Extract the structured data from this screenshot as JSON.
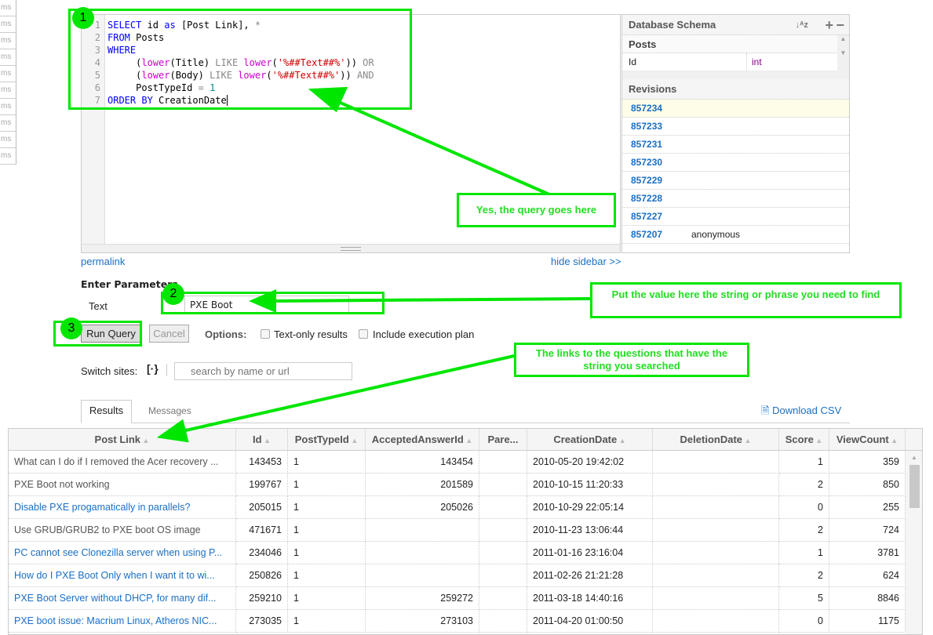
{
  "side_labels": [
    "ms",
    "ms",
    "ms",
    "ms",
    "ms",
    "ms",
    "ms",
    "ms",
    "ms",
    "ms"
  ],
  "editor": {
    "line_numbers": [
      "1",
      "2",
      "3",
      "4",
      "5",
      "6",
      "7"
    ]
  },
  "schema": {
    "title": "Database Schema",
    "table": "Posts",
    "column": {
      "name": "Id",
      "type": "int"
    },
    "revisions_title": "Revisions",
    "revisions": [
      {
        "id": "857234",
        "user": ""
      },
      {
        "id": "857233",
        "user": ""
      },
      {
        "id": "857231",
        "user": ""
      },
      {
        "id": "857230",
        "user": ""
      },
      {
        "id": "857229",
        "user": ""
      },
      {
        "id": "857228",
        "user": ""
      },
      {
        "id": "857227",
        "user": ""
      },
      {
        "id": "857207",
        "user": "anonymous"
      }
    ]
  },
  "links": {
    "permalink": "permalink",
    "hide_sidebar": "hide sidebar >>"
  },
  "params": {
    "heading": "Enter Parameters",
    "label": "Text",
    "value": "PXE Boot"
  },
  "actions": {
    "run": "Run Query",
    "cancel": "Cancel",
    "options": "Options:",
    "text_only": "Text-only results",
    "exec_plan": "Include execution plan"
  },
  "switch": {
    "label": "Switch sites:",
    "placeholder": "search by name or url"
  },
  "tabs": {
    "results": "Results",
    "messages": "Messages",
    "download": "Download CSV"
  },
  "table": {
    "headers": [
      "Post Link",
      "Id",
      "PostTypeId",
      "AcceptedAnswerId",
      "Pare...",
      "CreationDate",
      "DeletionDate",
      "Score",
      "ViewCount"
    ],
    "rows": [
      [
        "What can I do if I removed the Acer recovery ...",
        "143453",
        "1",
        "143454",
        "",
        "2010-05-20 19:42:02",
        "",
        "1",
        "359"
      ],
      [
        "PXE Boot not working",
        "199767",
        "1",
        "201589",
        "",
        "2010-10-15 11:20:33",
        "",
        "2",
        "850"
      ],
      [
        "Disable PXE progamatically in parallels?",
        "205015",
        "1",
        "205026",
        "",
        "2010-10-29 22:05:14",
        "",
        "0",
        "255"
      ],
      [
        "Use GRUB/GRUB2 to PXE boot OS image",
        "471671",
        "1",
        "",
        "",
        "2010-11-23 13:06:44",
        "",
        "2",
        "724"
      ],
      [
        "PC cannot see Clonezilla server when using P...",
        "234046",
        "1",
        "",
        "",
        "2011-01-16 23:16:04",
        "",
        "1",
        "3781"
      ],
      [
        "How do I PXE Boot Only when I want it to wi...",
        "250826",
        "1",
        "",
        "",
        "2011-02-26 21:21:28",
        "",
        "2",
        "624"
      ],
      [
        "PXE Boot Server without DHCP, for many dif...",
        "259210",
        "1",
        "259272",
        "",
        "2011-03-18 14:40:16",
        "",
        "5",
        "8846"
      ],
      [
        "PXE boot issue: Macrium Linux, Atheros NIC...",
        "273035",
        "1",
        "273103",
        "",
        "2011-04-20 01:00:50",
        "",
        "0",
        "1175"
      ]
    ],
    "visited": [
      true,
      true,
      false,
      true,
      false,
      false,
      false,
      false
    ]
  },
  "annotations": {
    "c1": "1",
    "c2": "2",
    "c3": "3",
    "query": "Yes, the query goes here",
    "value": "Put the value here the string or phrase you need to find",
    "links": "The links to the questions that have the string you searched"
  },
  "colors": {
    "annotation": "#00e600",
    "link": "#1a6fc4"
  }
}
